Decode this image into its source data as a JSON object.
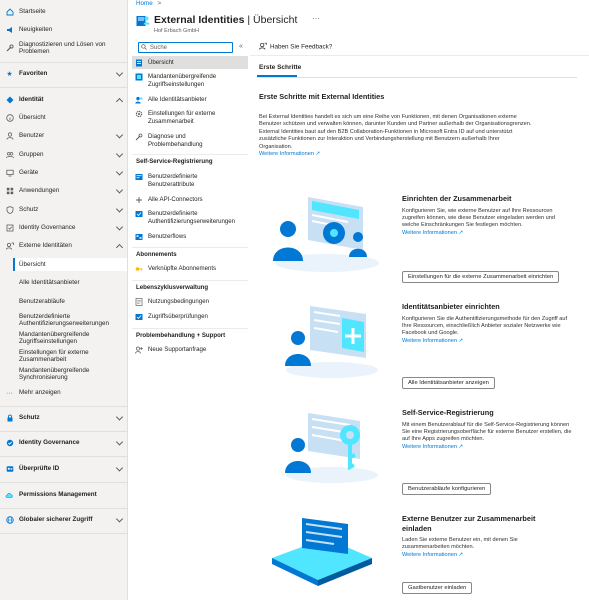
{
  "sidebar": {
    "items": [
      {
        "label": "Startseite",
        "icon": "home-icon"
      },
      {
        "label": "Neuigkeiten",
        "icon": "megaphone-icon"
      },
      {
        "label": "Diagnostizieren und Lösen von Problemen",
        "icon": "wrench-icon"
      },
      {
        "label": "Favoriten",
        "icon": "star-icon"
      },
      {
        "label": "Identität",
        "icon": "diamond-icon"
      },
      {
        "label": "Übersicht",
        "icon": "info-icon"
      },
      {
        "label": "Benutzer",
        "icon": "user-icon"
      },
      {
        "label": "Gruppen",
        "icon": "group-icon"
      },
      {
        "label": "Geräte",
        "icon": "device-icon"
      },
      {
        "label": "Anwendungen",
        "icon": "apps-icon"
      },
      {
        "label": "Schutz",
        "icon": "shield-icon"
      },
      {
        "label": "Identity Governance",
        "icon": "governance-icon"
      },
      {
        "label": "Externe Identitäten",
        "icon": "external-icon"
      },
      {
        "label": "Übersicht"
      },
      {
        "label": "Alle Identitätsanbieter"
      },
      {
        "label": "Benutzerabläufe"
      },
      {
        "label": "Benutzerdefinierte Authentifizierungserweiterungen"
      },
      {
        "label": "Mandantenübergreifende Zugriffseinstellungen"
      },
      {
        "label": "Einstellungen für externe Zusammenarbeit"
      },
      {
        "label": "Mandantenübergreifende Synchronisierung"
      },
      {
        "label": "Mehr anzeigen",
        "icon": "ellipsis-icon"
      },
      {
        "label": "Schutz",
        "icon": "lock-icon"
      },
      {
        "label": "Identity Governance",
        "icon": "governance-icon"
      },
      {
        "label": "Überprüfte ID",
        "icon": "verified-icon"
      },
      {
        "label": "Permissions Management",
        "icon": "cloud-icon"
      },
      {
        "label": "Globaler sicherer Zugriff",
        "icon": "globe-icon"
      }
    ]
  },
  "breadcrumb": {
    "home": "Home",
    "sep": ">"
  },
  "header": {
    "title_main": "External Identities",
    "title_sep": " | ",
    "title_page": "Übersicht",
    "company": "Hof Erbach GmbH",
    "more": "···"
  },
  "search": {
    "placeholder": "Suche",
    "collapse": "«"
  },
  "nav": {
    "items": [
      {
        "label": "Übersicht",
        "icon": "overview-icon"
      },
      {
        "label": "Mandantenübergreifende Zugriffseinstellungen",
        "icon": "cross-tenant-icon"
      },
      {
        "label": "Alle Identitätsanbieter",
        "icon": "identity-providers-icon"
      },
      {
        "label": "Einstellungen für externe Zusammenarbeit",
        "icon": "gear-icon"
      },
      {
        "label": "Diagnose und Problembehandlung",
        "icon": "diagnose-icon"
      },
      {
        "label": "Benutzerdefinierte Benutzerattribute",
        "icon": "attributes-icon"
      },
      {
        "label": "Alle API-Connectors",
        "icon": "api-icon"
      },
      {
        "label": "Benutzerdefinierte Authentifizierungserweiterungen",
        "icon": "extension-icon"
      },
      {
        "label": "Benutzerflows",
        "icon": "flows-icon"
      },
      {
        "label": "Verknüpfte Abonnements",
        "icon": "key-icon"
      },
      {
        "label": "Nutzungsbedingungen",
        "icon": "terms-icon"
      },
      {
        "label": "Zugriffsüberprüfungen",
        "icon": "review-icon"
      },
      {
        "label": "Neue Supportanfrage",
        "icon": "support-icon"
      }
    ],
    "headers": [
      "Self-Service-Registrierung",
      "Abonnements",
      "Lebenszyklusverwaltung",
      "Problembehandlung + Support"
    ]
  },
  "command": {
    "feedback": "Haben Sie Feedback?"
  },
  "tab": {
    "label": "Erste Schritte"
  },
  "intro": {
    "title": "Erste Schritte mit External Identities",
    "text": "Bei External Identities handelt es sich um eine Reihe von Funktionen, mit denen Organisationen externe Benutzer schützen und verwalten können, darunter Kunden und Partner außerhalb der Organisationsgrenzen. External Identities baut auf den B2B Collaboration-Funktionen in Microsoft Entra ID auf und unterstützt zusätzliche Funktionen zur Interaktion und Verbindungsherstellung mit Benutzern außerhalb Ihrer Organisation.",
    "link": "Weitere Informationen ↗"
  },
  "cards": [
    {
      "title": "Einrichten der Zusammenarbeit",
      "text": "Konfigurieren Sie, wie externe Benutzer auf Ihre Ressourcen zugreifen können, wie diese Benutzer eingeladen werden und welche Einschränkungen Sie festlegen möchten.",
      "link": "Weitere Informationen ↗",
      "button": "Einstellungen für die externe Zusammenarbeit einrichten"
    },
    {
      "title": "Identitätsanbieter einrichten",
      "text": "Konfigurieren Sie die Authentifizierungsmethode für den Zugriff auf Ihre Ressourcen, einschließlich Anbieter sozialer Netzwerke wie Facebook und Google.",
      "link": "Weitere Informationen ↗",
      "button": "Alle Identitätsanbieter anzeigen"
    },
    {
      "title": "Self-Service-Registrierung",
      "text": "Mit einem Benutzerablauf für die Self-Service-Registrierung können Sie eine Registrierungsoberfläche für externe Benutzer erstellen, die auf Ihre Apps zugreifen möchten.",
      "link": "Weitere Informationen ↗",
      "button": "Benutzerabläufe konfigurieren"
    },
    {
      "title": "Externe Benutzer zur Zusammenarbeit einladen",
      "text": "Laden Sie externe Benutzer ein, mit denen Sie zusammenarbeiten möchten.",
      "link": "Weitere Informationen ↗",
      "button": "Gastbenutzer einladen"
    }
  ],
  "colors": {
    "accent": "#0078d4",
    "sidebar_bg": "#f3f2f1",
    "illustration_light": "#c7e0f4"
  }
}
